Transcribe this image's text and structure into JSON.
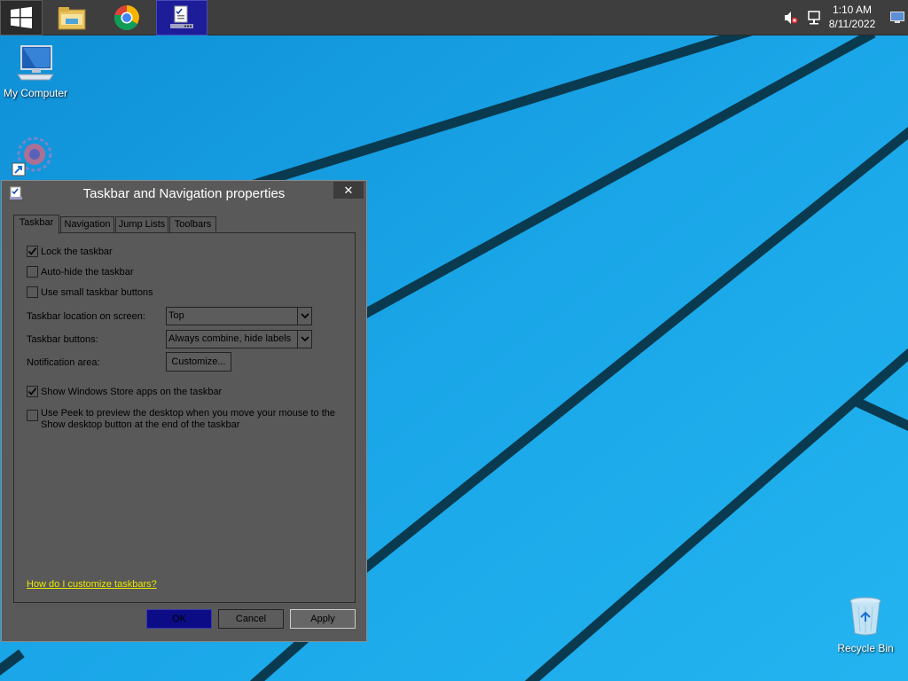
{
  "taskbar": {
    "apps": [
      {
        "name": "Start"
      },
      {
        "name": "File Explorer"
      },
      {
        "name": "Google Chrome"
      },
      {
        "name": "Taskbar and Navigation properties"
      }
    ],
    "clock": {
      "time": "1:10 AM",
      "date": "8/11/2022"
    }
  },
  "desktop": {
    "icons": [
      {
        "label": "My Computer"
      },
      {
        "label": ""
      },
      {
        "label": "Recycle Bin"
      }
    ]
  },
  "dialog": {
    "title": "Taskbar and Navigation properties",
    "close_label": "✕",
    "tabs": [
      {
        "label": "Taskbar",
        "active": true
      },
      {
        "label": "Navigation",
        "active": false
      },
      {
        "label": "Jump Lists",
        "active": false
      },
      {
        "label": "Toolbars",
        "active": false
      }
    ],
    "options": {
      "lock_taskbar": {
        "label": "Lock the taskbar",
        "checked": true
      },
      "auto_hide": {
        "label": "Auto-hide the taskbar",
        "checked": false
      },
      "small_buttons": {
        "label": "Use small taskbar buttons",
        "checked": false
      },
      "store_apps": {
        "label": "Show Windows Store apps on the taskbar",
        "checked": true
      },
      "peek_line1": "Use Peek to preview the desktop when you move your mouse to the",
      "peek_line2": "Show desktop button at the end of the taskbar",
      "peek_checked": false
    },
    "location": {
      "label": "Taskbar location on screen:",
      "value": "Top"
    },
    "buttons_setting": {
      "label": "Taskbar buttons:",
      "value": "Always combine, hide labels"
    },
    "notification": {
      "label": "Notification area:",
      "button": "Customize..."
    },
    "help_link": "How do I customize taskbars?",
    "footer": {
      "ok": "OK",
      "cancel": "Cancel",
      "apply": "Apply"
    }
  },
  "colors": {
    "wallpaper": "#1aa3e6",
    "dialog_bg": "#595959",
    "taskbar_bg": "#3e3e3e",
    "active_task": "#1d1d9a",
    "ok_button": "#0c0c86",
    "link": "#e8e800"
  },
  "icons": [
    "windows-logo-icon",
    "folder-icon",
    "chrome-icon",
    "properties-icon",
    "volume-muted-icon",
    "network-icon",
    "show-desktop-icon",
    "computer-icon",
    "gear-shortcut-icon",
    "recycle-bin-icon",
    "checkmark-icon",
    "dropdown-arrow-icon"
  ]
}
